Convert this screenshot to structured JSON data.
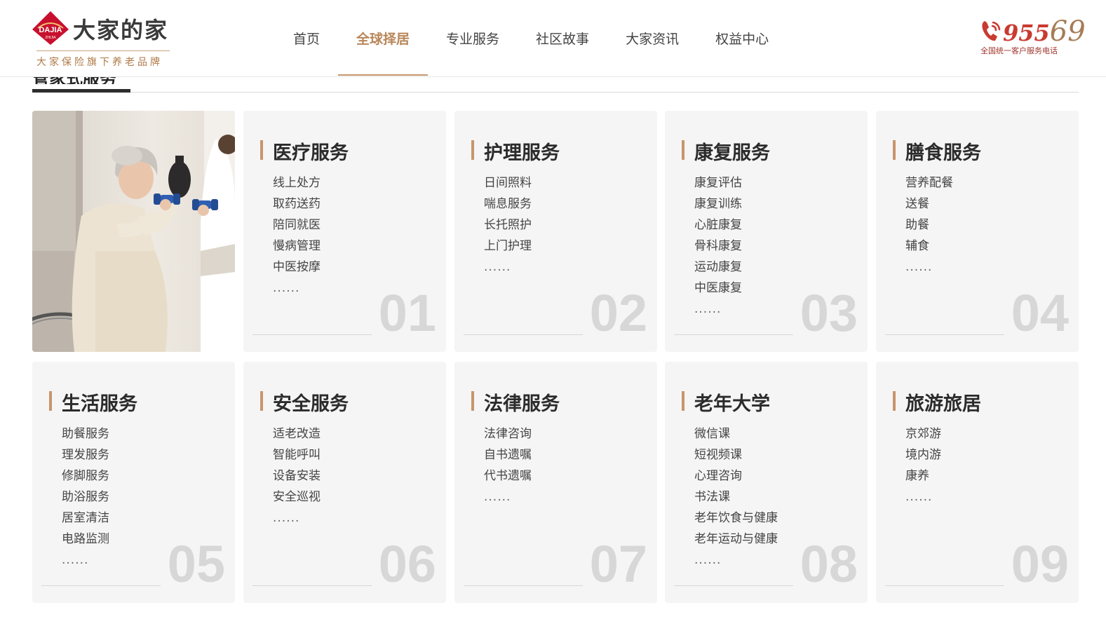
{
  "brand": {
    "name": "大家的家",
    "slogan": "大家保险旗下养老品牌",
    "mark_text": "DAJIA",
    "mark_subtext": "ZHIJIA",
    "colors": {
      "primary": "#c8102e",
      "accent": "#b8865a"
    }
  },
  "nav": {
    "items": [
      {
        "label": "首页",
        "active": false
      },
      {
        "label": "全球择居",
        "active": true
      },
      {
        "label": "专业服务",
        "active": false
      },
      {
        "label": "社区故事",
        "active": false
      },
      {
        "label": "大家资讯",
        "active": false
      },
      {
        "label": "权益中心",
        "active": false
      }
    ]
  },
  "hotline": {
    "number_main": "955",
    "number_tail": "69",
    "label": "全国统一客户服务电话",
    "icon": "phone-icon"
  },
  "section": {
    "title": "管家式服务"
  },
  "photo": {
    "icon": "elderly-woman-exercise-photo"
  },
  "services": [
    {
      "title": "医疗服务",
      "items": [
        "线上处方",
        "取药送药",
        "陪同就医",
        "慢病管理",
        "中医按摩"
      ],
      "more": "......",
      "num": "01"
    },
    {
      "title": "护理服务",
      "items": [
        "日间照料",
        "喘息服务",
        "长托照护",
        "上门护理"
      ],
      "more": "......",
      "num": "02"
    },
    {
      "title": "康复服务",
      "items": [
        "康复评估",
        "康复训练",
        "心脏康复",
        "骨科康复",
        "运动康复",
        "中医康复"
      ],
      "more": "......",
      "num": "03"
    },
    {
      "title": "膳食服务",
      "items": [
        "营养配餐",
        "送餐",
        "助餐",
        "辅食"
      ],
      "more": "......",
      "num": "04"
    },
    {
      "title": "生活服务",
      "items": [
        "助餐服务",
        "理发服务",
        "修脚服务",
        "助浴服务",
        "居室清洁",
        "电路监测"
      ],
      "more": "......",
      "num": "05"
    },
    {
      "title": "安全服务",
      "items": [
        "适老改造",
        "智能呼叫",
        "设备安装",
        "安全巡视"
      ],
      "more": "......",
      "num": "06"
    },
    {
      "title": "法律服务",
      "items": [
        "法律咨询",
        "自书遗嘱",
        "代书遗嘱"
      ],
      "more": "......",
      "num": "07"
    },
    {
      "title": "老年大学",
      "items": [
        "微信课",
        "短视频课",
        "心理咨询",
        "书法课",
        "老年饮食与健康",
        "老年运动与健康"
      ],
      "more": "......",
      "num": "08"
    },
    {
      "title": "旅游旅居",
      "items": [
        "京郊游",
        "境内游",
        "康养"
      ],
      "more": "......",
      "num": "09"
    }
  ]
}
